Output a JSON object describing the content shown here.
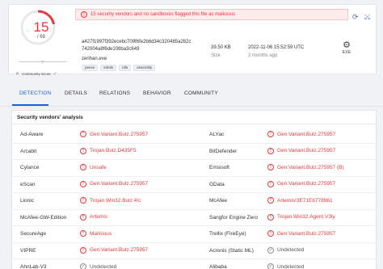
{
  "score": {
    "detected": "15",
    "total": "/ 69"
  },
  "community_score": {
    "value": "?",
    "label": "Community Score"
  },
  "alert": {
    "text": "15 security vendors and no sandboxes flagged this file as malicious"
  },
  "file": {
    "hash_line1": "a427f1997f392ecebc709f6fe2b6d34c320485a282c",
    "hash_line2": "742004a8f6de108ba3c649",
    "name": "zenhan.exe",
    "tags": [
      "peexe",
      "64bits",
      "idle",
      "assembly"
    ],
    "size": "39.50 KB",
    "size_label": "Size",
    "date": "2022-11-06 15:52:59 UTC",
    "date_relative": "2 months ago",
    "type": "EXE"
  },
  "tabs": [
    "DETECTION",
    "DETAILS",
    "RELATIONS",
    "BEHAVIOR",
    "COMMUNITY"
  ],
  "vendors_title": "Security vendors' analysis",
  "vendors": [
    {
      "left": "Ad-Aware",
      "left_result": "Gen:Variant.Bulz.275957",
      "left_status": "malicious",
      "right": "ALYac",
      "right_result": "Gen:Variant.Bulz.275957",
      "right_status": "malicious"
    },
    {
      "left": "Arcabit",
      "left_result": "Trojan.Bulz.D435F5",
      "left_status": "malicious",
      "right": "BitDefender",
      "right_result": "Gen:Variant.Bulz.275957",
      "right_status": "malicious"
    },
    {
      "left": "Cylance",
      "left_result": "Unsafe",
      "left_status": "malicious",
      "right": "Emsisoft",
      "right_result": "Gen:Variant.Bulz.275957 (B)",
      "right_status": "malicious"
    },
    {
      "left": "eScan",
      "left_result": "Gen:Variant.Bulz.275957",
      "left_status": "malicious",
      "right": "GData",
      "right_result": "Gen:Variant.Bulz.275957",
      "right_status": "malicious"
    },
    {
      "left": "Lionic",
      "left_result": "Trojan.Win32.Bulz.4!c",
      "left_status": "malicious",
      "right": "McAfee",
      "right_result": "Artemis!3E71E6778961",
      "right_status": "malicious"
    },
    {
      "left": "McAfee-GW-Edition",
      "left_result": "Artemis",
      "left_status": "malicious",
      "right": "Sangfor Engine Zero",
      "right_result": "Trojan.Win32.Agent.V3ly",
      "right_status": "malicious"
    },
    {
      "left": "SecureAge",
      "left_result": "Malicious",
      "left_status": "malicious",
      "right": "Trellix (FireEye)",
      "right_result": "Gen:Variant.Bulz.275957",
      "right_status": "malicious"
    },
    {
      "left": "VIPRE",
      "left_result": "Gen:Variant.Bulz.275957",
      "left_status": "malicious",
      "right": "Acronis (Static ML)",
      "right_result": "Undetected",
      "right_status": "undetected"
    },
    {
      "left": "AhnLab-V3",
      "left_result": "Undetected",
      "left_status": "undetected",
      "right": "Alibaba",
      "right_result": "Undetected",
      "right_status": "undetected"
    }
  ],
  "colors": {
    "malicious": "#e5393c",
    "accent": "#1e63d6"
  }
}
